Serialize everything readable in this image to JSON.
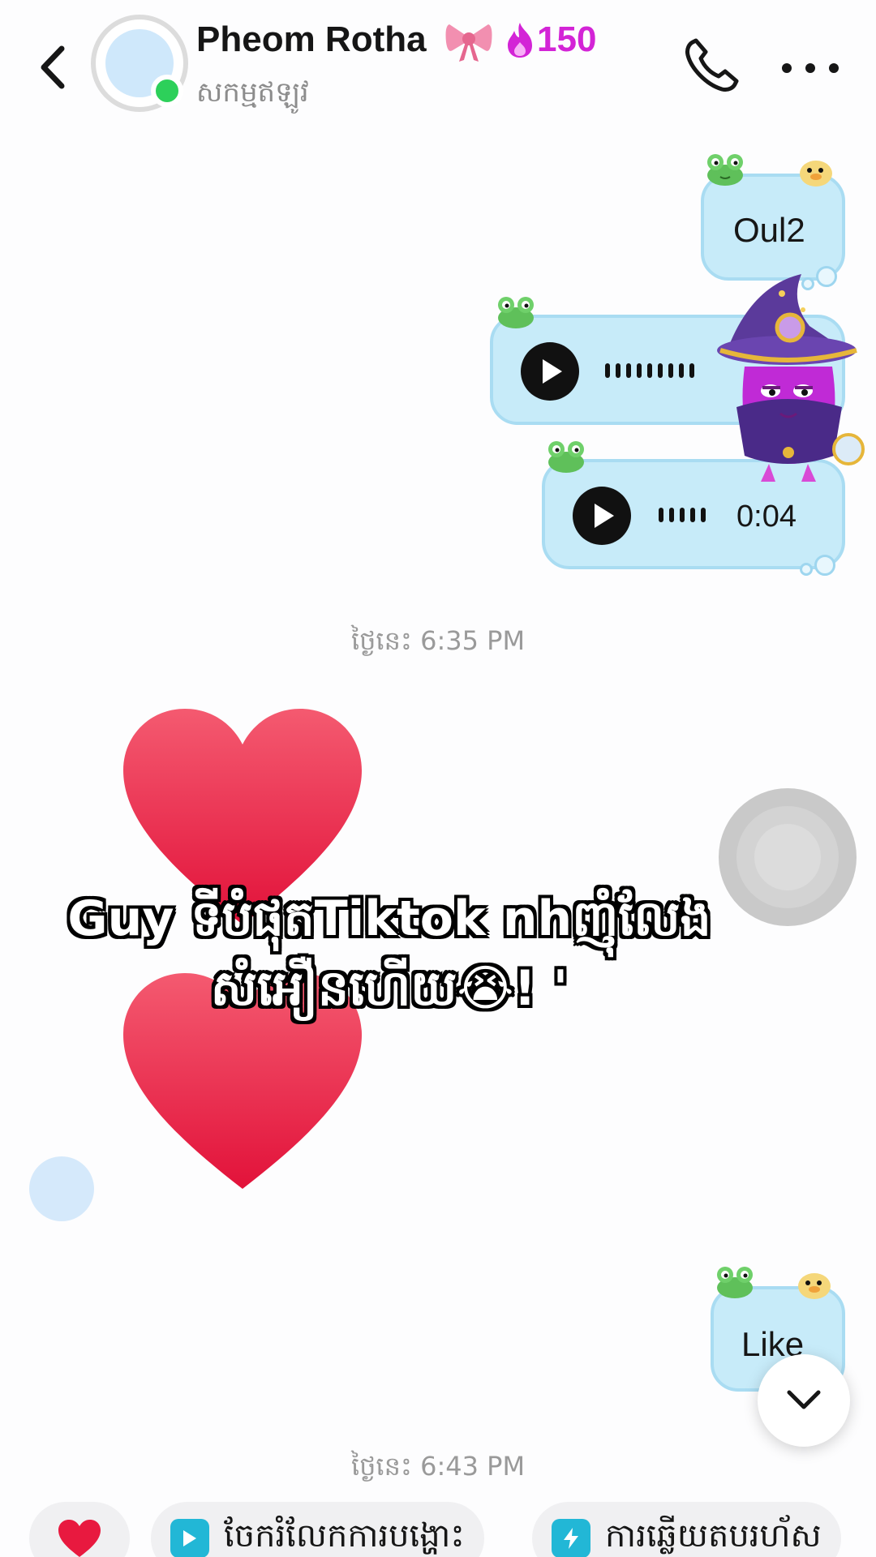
{
  "header": {
    "back_icon": "chevron-left-icon",
    "contact_name": "Pheom Rotha",
    "ribbon_emoji": "🎀",
    "streak_icon": "flame-icon",
    "streak_count": "150",
    "status": "សកម្មឥឡូវ",
    "call_icon": "phone-icon",
    "more_icon": "more-dots-icon",
    "accent_color": "#d324d6",
    "online_color": "#2dd05a"
  },
  "messages": [
    {
      "type": "text",
      "side": "right",
      "text": "Oul2"
    },
    {
      "type": "voice",
      "side": "right",
      "duration": ""
    },
    {
      "type": "voice",
      "side": "right",
      "duration": "0:04"
    },
    {
      "type": "timestamp",
      "text": "ថ្ងៃនេះ 6:35 PM"
    },
    {
      "type": "sticker",
      "side": "left",
      "content": "heart"
    },
    {
      "type": "sticker",
      "side": "left",
      "content": "heart"
    },
    {
      "type": "text",
      "side": "right",
      "text": "Like"
    },
    {
      "type": "timestamp",
      "text": "ថ្ងៃនេះ 6:43 PM"
    }
  ],
  "overlay_caption": {
    "line1": "Guy ទីបំផុតTiktok nhញុំលែង",
    "line2": "សំអឿនហើយ😭! '"
  },
  "bubble_color": "#c7ebf9",
  "quick_replies": [
    {
      "icon": "heart-icon",
      "label": ""
    },
    {
      "icon": "play-square-icon",
      "label": "ចែករំលែកការបង្ហោះ"
    },
    {
      "icon": "lightning-icon",
      "label": "ការឆ្លើយតបរហ័ស"
    }
  ],
  "scroll_down_icon": "chevron-down-icon"
}
